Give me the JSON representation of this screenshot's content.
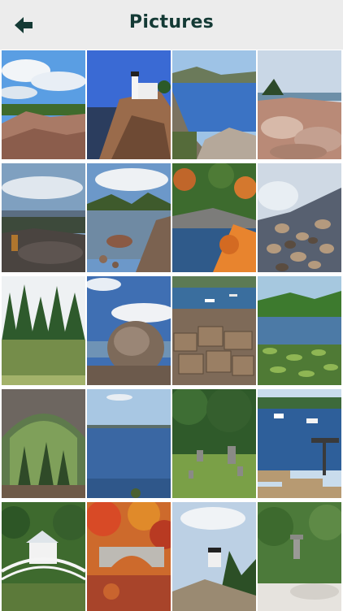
{
  "header": {
    "title": "Pictures",
    "back_icon": "arrow-left-icon"
  },
  "gallery": {
    "photos": [
      {
        "subject": "coastal-rocks-blue-sky"
      },
      {
        "subject": "lighthouse-on-cliff"
      },
      {
        "subject": "rocky-coastline-sea"
      },
      {
        "subject": "pink-granite-shore"
      },
      {
        "subject": "hiker-dog-mountain-view"
      },
      {
        "subject": "lake-with-mountains"
      },
      {
        "subject": "autumn-forest-lake"
      },
      {
        "subject": "cobblestone-beach-waves"
      },
      {
        "subject": "pine-forest-pond"
      },
      {
        "subject": "glacial-boulder-summit"
      },
      {
        "subject": "harbor-lobster-traps"
      },
      {
        "subject": "lily-pad-pond"
      },
      {
        "subject": "stone-arch-bridge-forest"
      },
      {
        "subject": "ocean-view-trees"
      },
      {
        "subject": "old-cemetery-trees"
      },
      {
        "subject": "harbor-dock-boats"
      },
      {
        "subject": "white-footbridge-house"
      },
      {
        "subject": "autumn-stone-bridge"
      },
      {
        "subject": "lighthouse-pines"
      },
      {
        "subject": "japanese-garden-lantern"
      }
    ]
  }
}
